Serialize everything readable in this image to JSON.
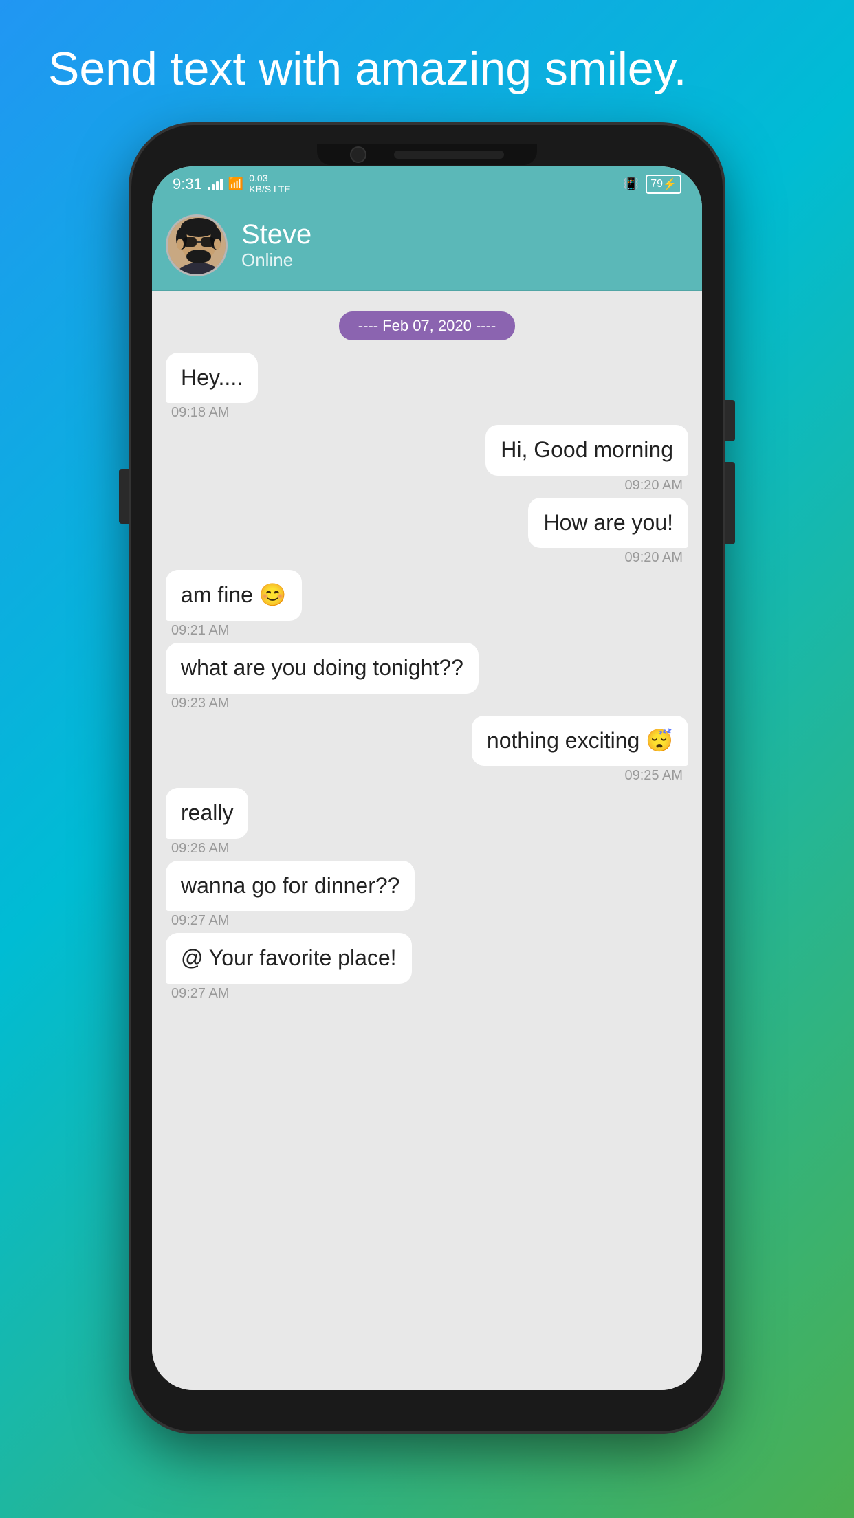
{
  "tagline": "Send text with amazing smiley.",
  "status": {
    "time": "9:31",
    "data_speed": "0.03",
    "data_unit": "KB/S",
    "network": "LTE",
    "battery": "79"
  },
  "contact": {
    "name": "Steve",
    "status": "Online"
  },
  "date_divider": "---- Feb 07, 2020 ----",
  "messages": [
    {
      "type": "received",
      "text": "Hey....",
      "time": "09:18 AM"
    },
    {
      "type": "sent",
      "text": "Hi, Good morning",
      "time": "09:20 AM"
    },
    {
      "type": "sent",
      "text": "How are you!",
      "time": "09:20 AM"
    },
    {
      "type": "received",
      "text": "am fine 😊",
      "time": "09:21 AM"
    },
    {
      "type": "received",
      "text": "what are you doing tonight??",
      "time": "09:23 AM"
    },
    {
      "type": "sent",
      "text": "nothing exciting 😴",
      "time": "09:25 AM"
    },
    {
      "type": "received",
      "text": "really",
      "time": "09:26 AM"
    },
    {
      "type": "received",
      "text": "wanna go for dinner??",
      "time": "09:27 AM"
    },
    {
      "type": "received",
      "text": "@ Your favorite place!",
      "time": "09:27 AM"
    }
  ]
}
